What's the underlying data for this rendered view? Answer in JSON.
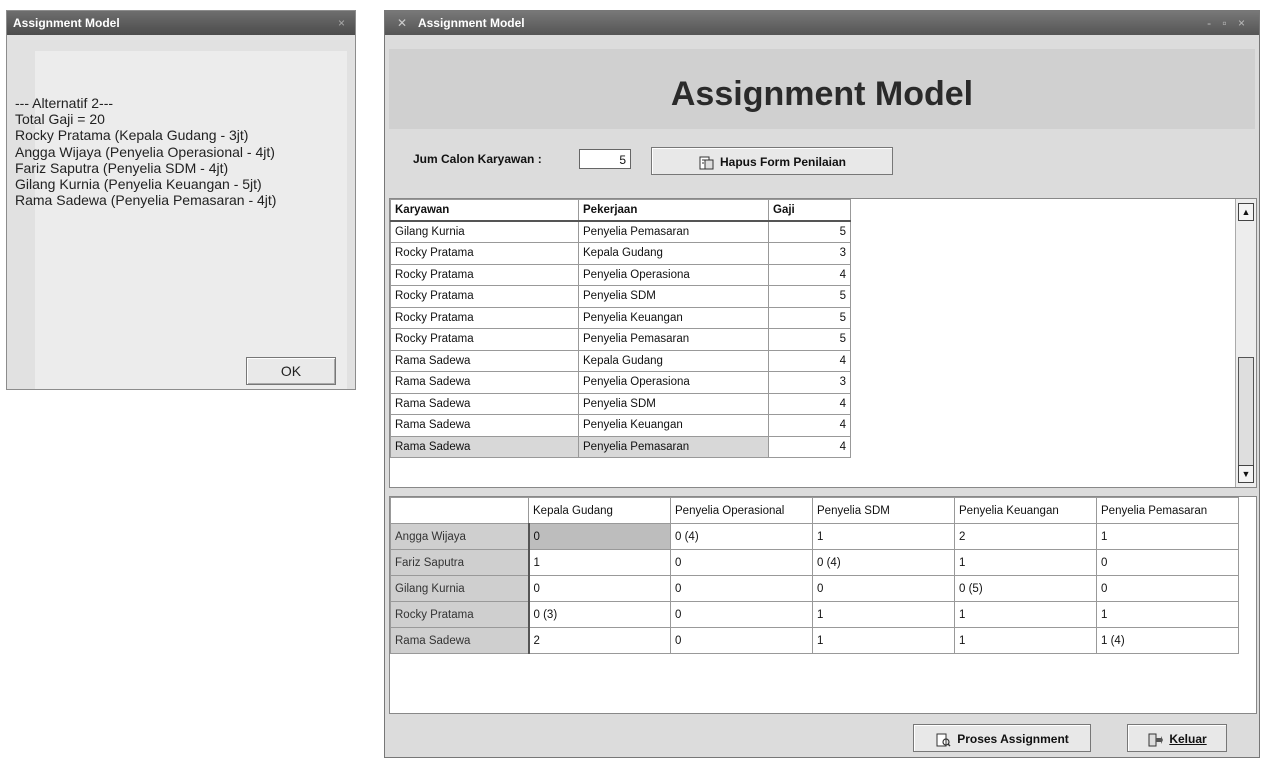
{
  "dialog": {
    "title": "Assignment Model",
    "close_glyph": "×",
    "lines": [
      "--- Alternatif 2---",
      "Total Gaji = 20",
      "Rocky  Pratama (Kepala  Gudang - 3jt)",
      "Angga  Wijaya (Penyelia Operasional - 4jt)",
      "Fariz  Saputra (Penyelia  SDM - 4jt)",
      "Gilang  Kurnia (Penyelia Keuangan - 5jt)",
      "Rama  Sadewa (Penyelia Pemasaran - 4jt)"
    ],
    "ok_label": "OK"
  },
  "window": {
    "title": "Assignment Model",
    "title_glyph": "✕",
    "controls": "- ▫ ×",
    "heading": "Assignment Model",
    "jum_label": "Jum Calon Karyawan :",
    "jum_value": "5",
    "hapus_label": "Hapus Form Penilaian",
    "proses_label": "Proses Assignment",
    "keluar_label": "Keluar"
  },
  "grid1": {
    "headers": [
      "Karyawan",
      "Pekerjaan",
      "Gaji"
    ],
    "rows": [
      [
        "Gilang Kurnia",
        "Penyelia Pemasaran",
        "5"
      ],
      [
        "Rocky Pratama",
        "Kepala Gudang",
        "3"
      ],
      [
        "Rocky Pratama",
        "Penyelia Operasiona",
        "4"
      ],
      [
        "Rocky Pratama",
        "Penyelia SDM",
        "5"
      ],
      [
        "Rocky Pratama",
        "Penyelia Keuangan",
        "5"
      ],
      [
        "Rocky Pratama",
        "Penyelia Pemasaran",
        "5"
      ],
      [
        "Rama Sadewa",
        "Kepala Gudang",
        "4"
      ],
      [
        "Rama Sadewa",
        "Penyelia Operasiona",
        "3"
      ],
      [
        "Rama Sadewa",
        "Penyelia SDM",
        "4"
      ],
      [
        "Rama Sadewa",
        "Penyelia Keuangan",
        "4"
      ],
      [
        "Rama Sadewa",
        "Penyelia Pemasaran",
        "4"
      ]
    ]
  },
  "grid2": {
    "headers": [
      "",
      "Kepala Gudang",
      "Penyelia Operasional",
      "Penyelia SDM",
      "Penyelia Keuangan",
      "Penyelia Pemasaran"
    ],
    "rows": [
      [
        "Angga Wijaya",
        "0",
        "0 (4)",
        "1",
        "2",
        "1"
      ],
      [
        "Fariz Saputra",
        "1",
        "0",
        "0 (4)",
        "1",
        "0"
      ],
      [
        "Gilang Kurnia",
        "0",
        "0",
        "0",
        "0 (5)",
        "0"
      ],
      [
        "Rocky Pratama",
        "0 (3)",
        "0",
        "1",
        "1",
        "1"
      ],
      [
        "Rama Sadewa",
        "2",
        "0",
        "1",
        "1",
        "1 (4)"
      ]
    ]
  }
}
